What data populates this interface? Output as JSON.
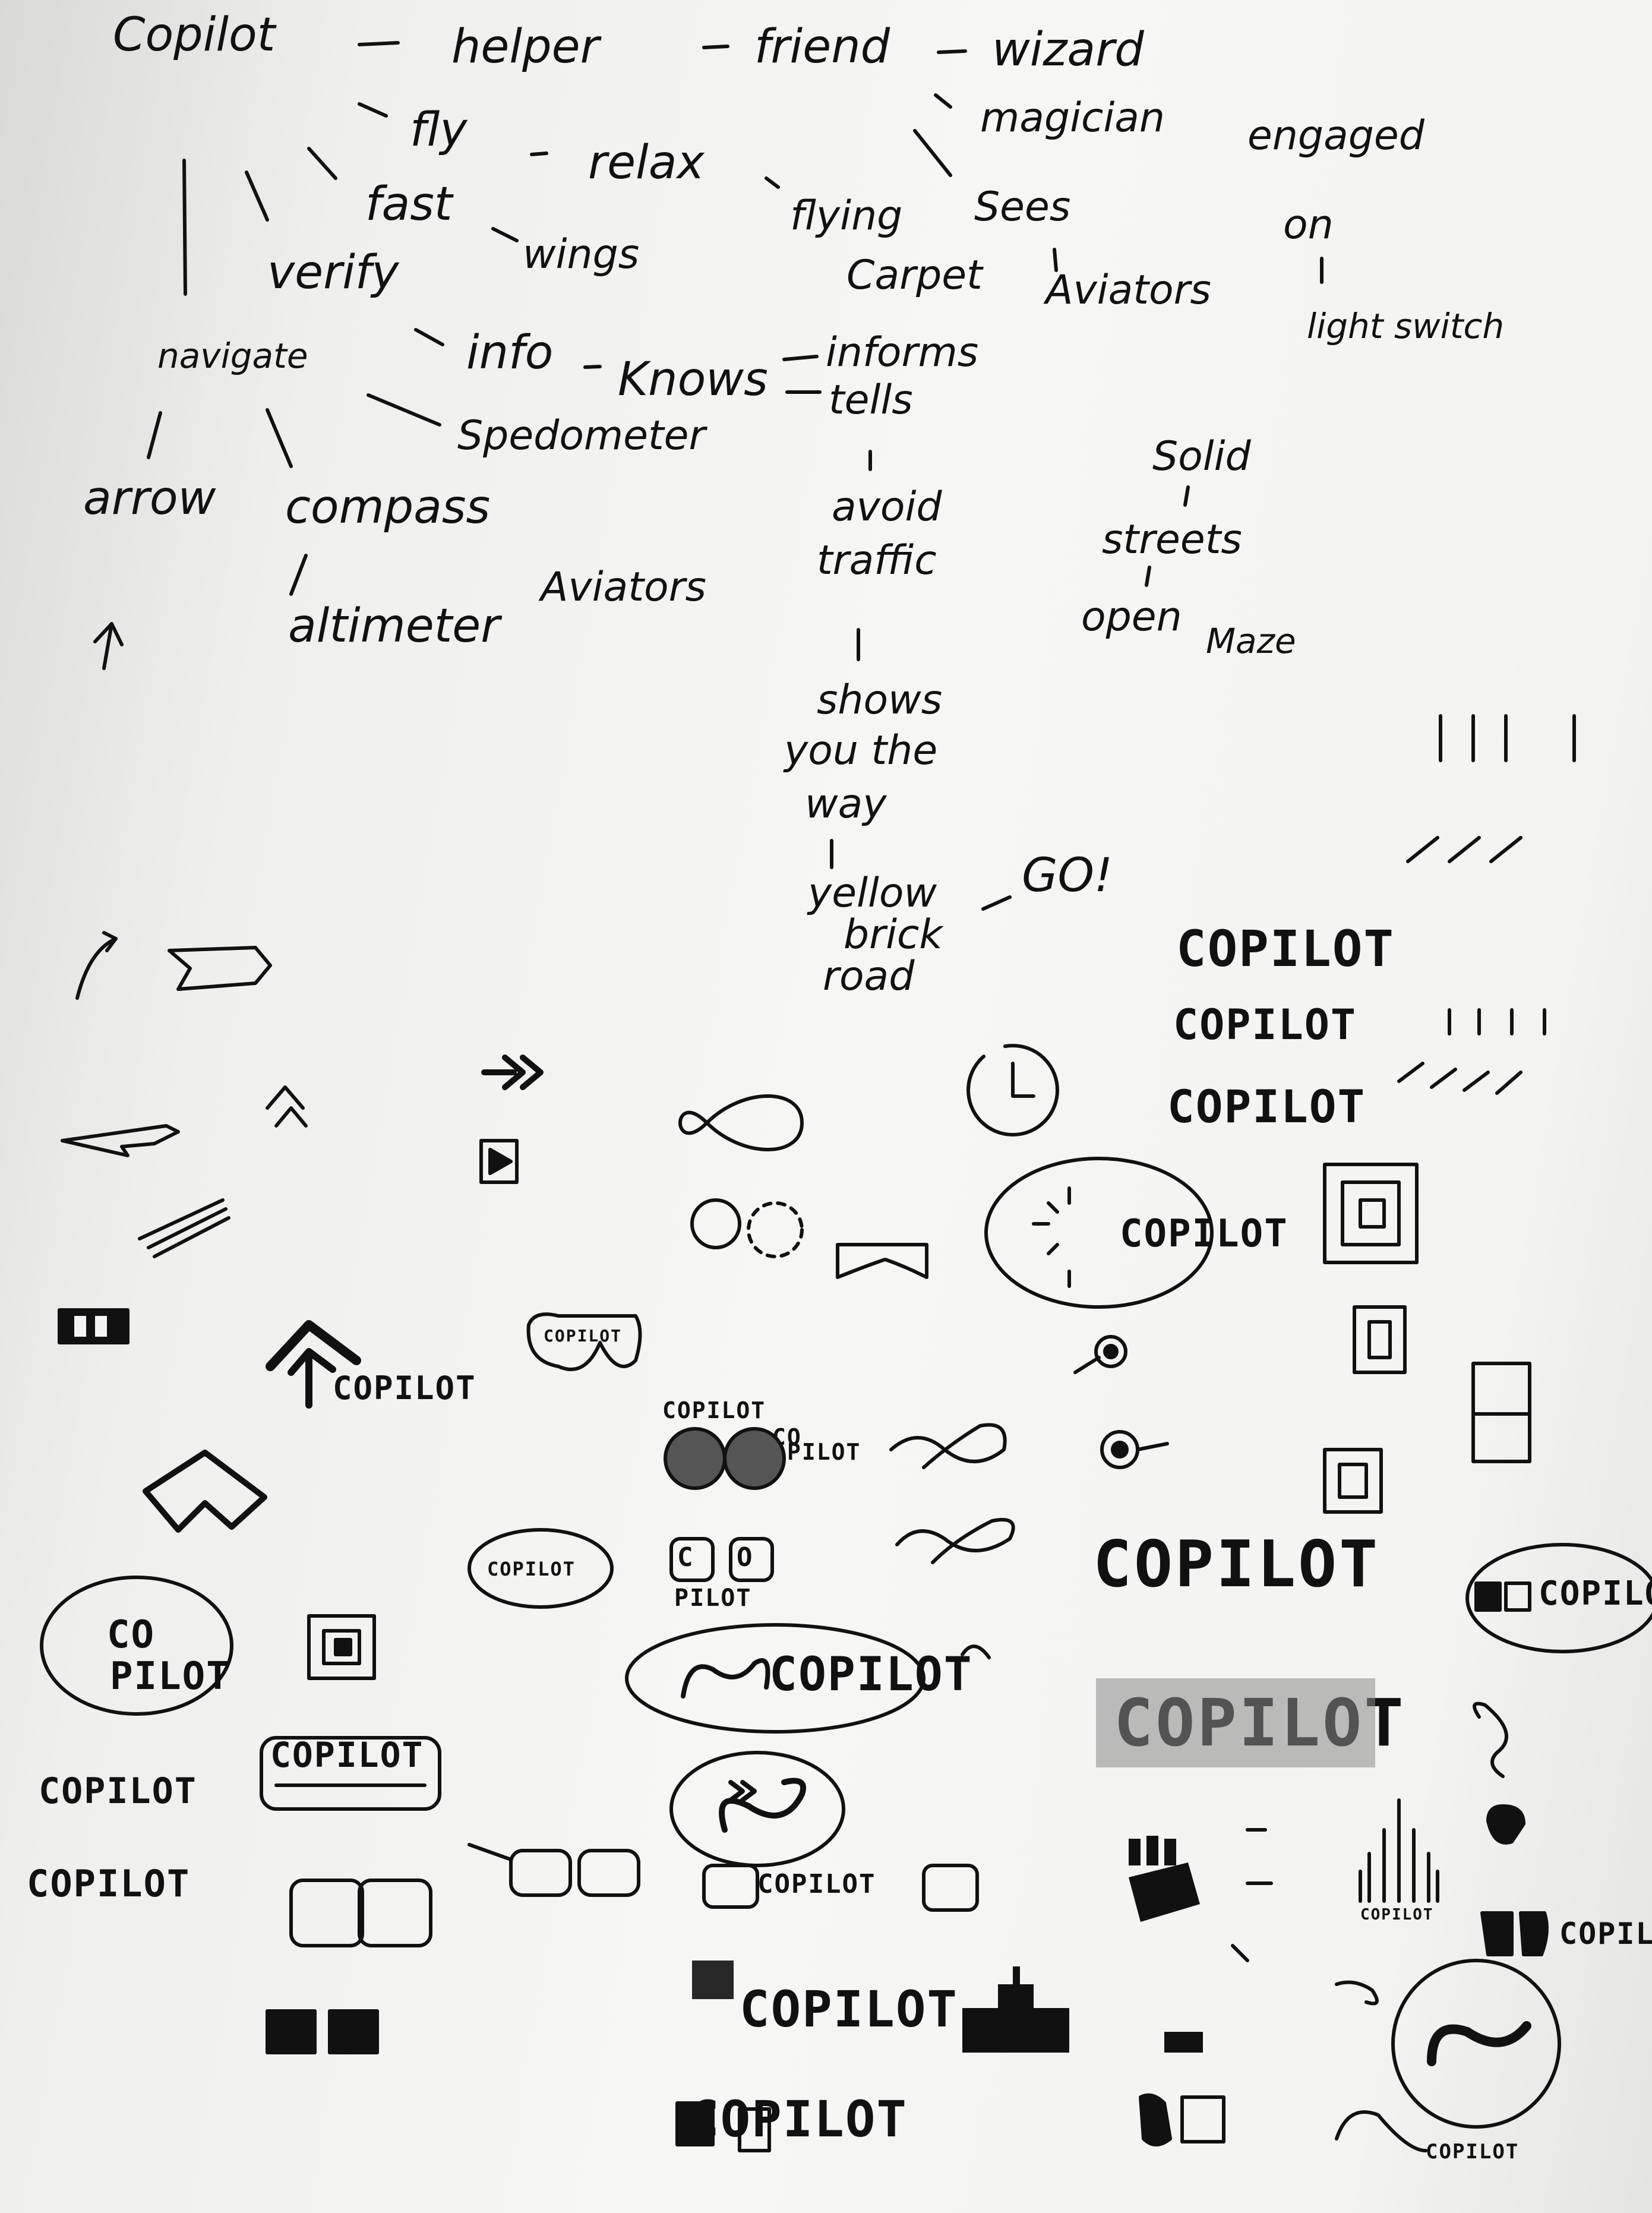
{
  "words": {
    "copilot": "Copilot",
    "helper": "helper",
    "friend": "friend",
    "wizard": "wizard",
    "magician": "magician",
    "engaged": "engaged",
    "fly": "fly",
    "relax": "relax",
    "fast": "fast",
    "flying": "flying",
    "carpet": "Carpet",
    "sees": "Sees",
    "on": "on",
    "wings": "wings",
    "verify": "verify",
    "aviators_top": "Aviators",
    "light_switch": "light switch",
    "navigate": "navigate",
    "info": "info",
    "knows": "Knows",
    "informs": "informs",
    "tells": "tells",
    "spedometer": "Spedometer",
    "solid": "Solid",
    "arrow": "arrow",
    "compass": "compass",
    "avoid": "avoid",
    "traffic": "traffic",
    "streets": "streets",
    "aviators_mid": "Aviators",
    "altimeter": "altimeter",
    "open": "open",
    "maze": "Maze",
    "shows": "shows",
    "you_the": "you the",
    "way": "way",
    "go": "GO!",
    "yellow": "yellow",
    "brick": "brick",
    "road": "road"
  },
  "logos": {
    "copilot_upper": "COPILOT",
    "co": "CO",
    "pilot": "PILOT",
    "co_split_c": "C",
    "co_split_o": "O",
    "pilot_split": "PILOT",
    "copilot_tiny": "COPILOT"
  },
  "colors": {
    "ink": "#111111",
    "paper": "#f4f4f2",
    "shade": "#8a8a8a"
  }
}
